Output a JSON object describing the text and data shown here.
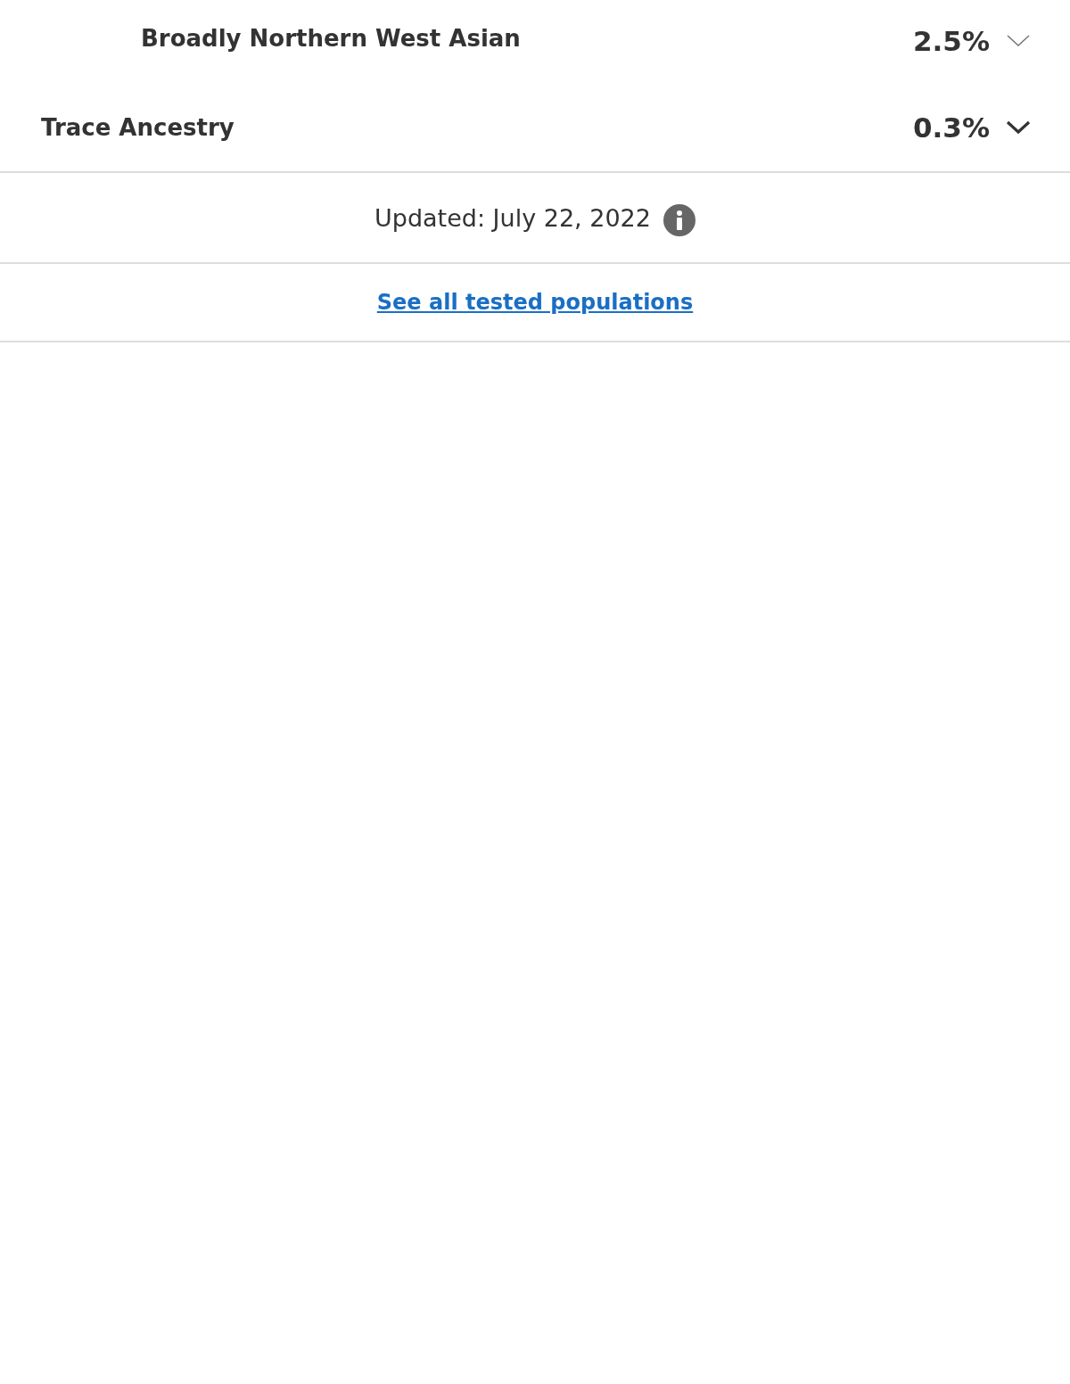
{
  "ancestry_rows": [
    {
      "kind": "subregion",
      "name": "Broadly Northern West Asian",
      "percent": "2.5%"
    },
    {
      "kind": "region",
      "name": "Trace Ancestry",
      "percent": "0.3%"
    }
  ],
  "updated": {
    "text": "Updated: July 22, 2022"
  },
  "link": {
    "text": "See all tested populations"
  }
}
